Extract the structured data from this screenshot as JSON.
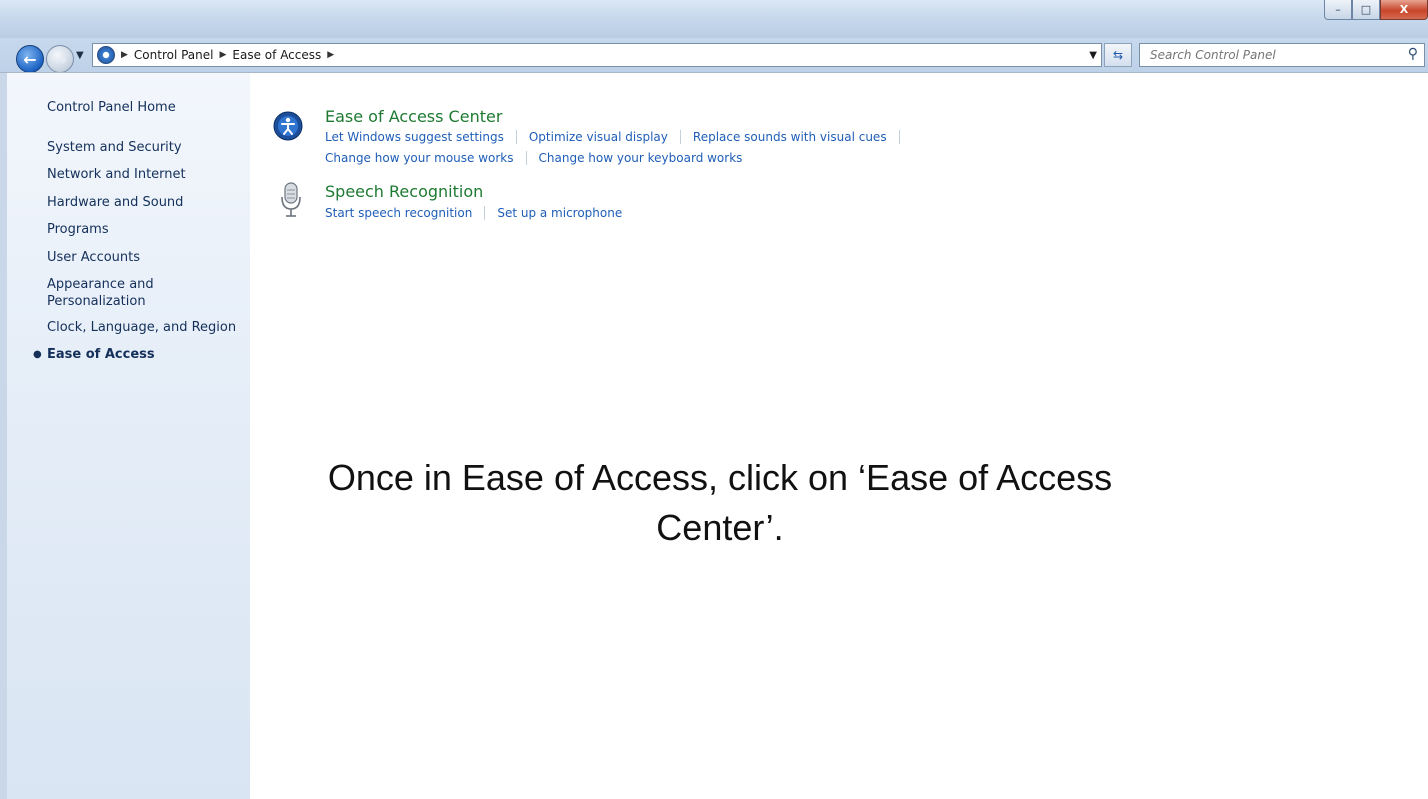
{
  "window": {
    "controls": {
      "minimize": "–",
      "maximize": "□",
      "close": "X"
    }
  },
  "nav": {
    "back_icon": "back-arrow-icon",
    "forward_icon": "forward-arrow-icon",
    "breadcrumb": [
      "Control Panel",
      "Ease of Access"
    ],
    "search_placeholder": "Search Control Panel"
  },
  "sidebar": {
    "home": "Control Panel Home",
    "items": [
      "System and Security",
      "Network and Internet",
      "Hardware and Sound",
      "Programs",
      "User Accounts",
      "Appearance and Personalization",
      "Clock, Language, and Region",
      "Ease of Access"
    ],
    "active": "Ease of Access"
  },
  "main": {
    "sections": [
      {
        "title": "Ease of Access Center",
        "icon": "ease-of-access-icon",
        "links_row1": [
          "Let Windows suggest settings",
          "Optimize visual display",
          "Replace sounds with visual cues"
        ],
        "links_row2": [
          "Change how your mouse works",
          "Change how your keyboard works"
        ]
      },
      {
        "title": "Speech Recognition",
        "icon": "microphone-icon",
        "links_row1": [
          "Start speech recognition",
          "Set up a microphone"
        ]
      }
    ]
  },
  "caption": "Once in Ease of Access, click on ‘Ease of Access Center’.",
  "colors": {
    "category_title": "#1e7a32",
    "link": "#1f5eb8",
    "sidebar_text": "#14305a"
  }
}
